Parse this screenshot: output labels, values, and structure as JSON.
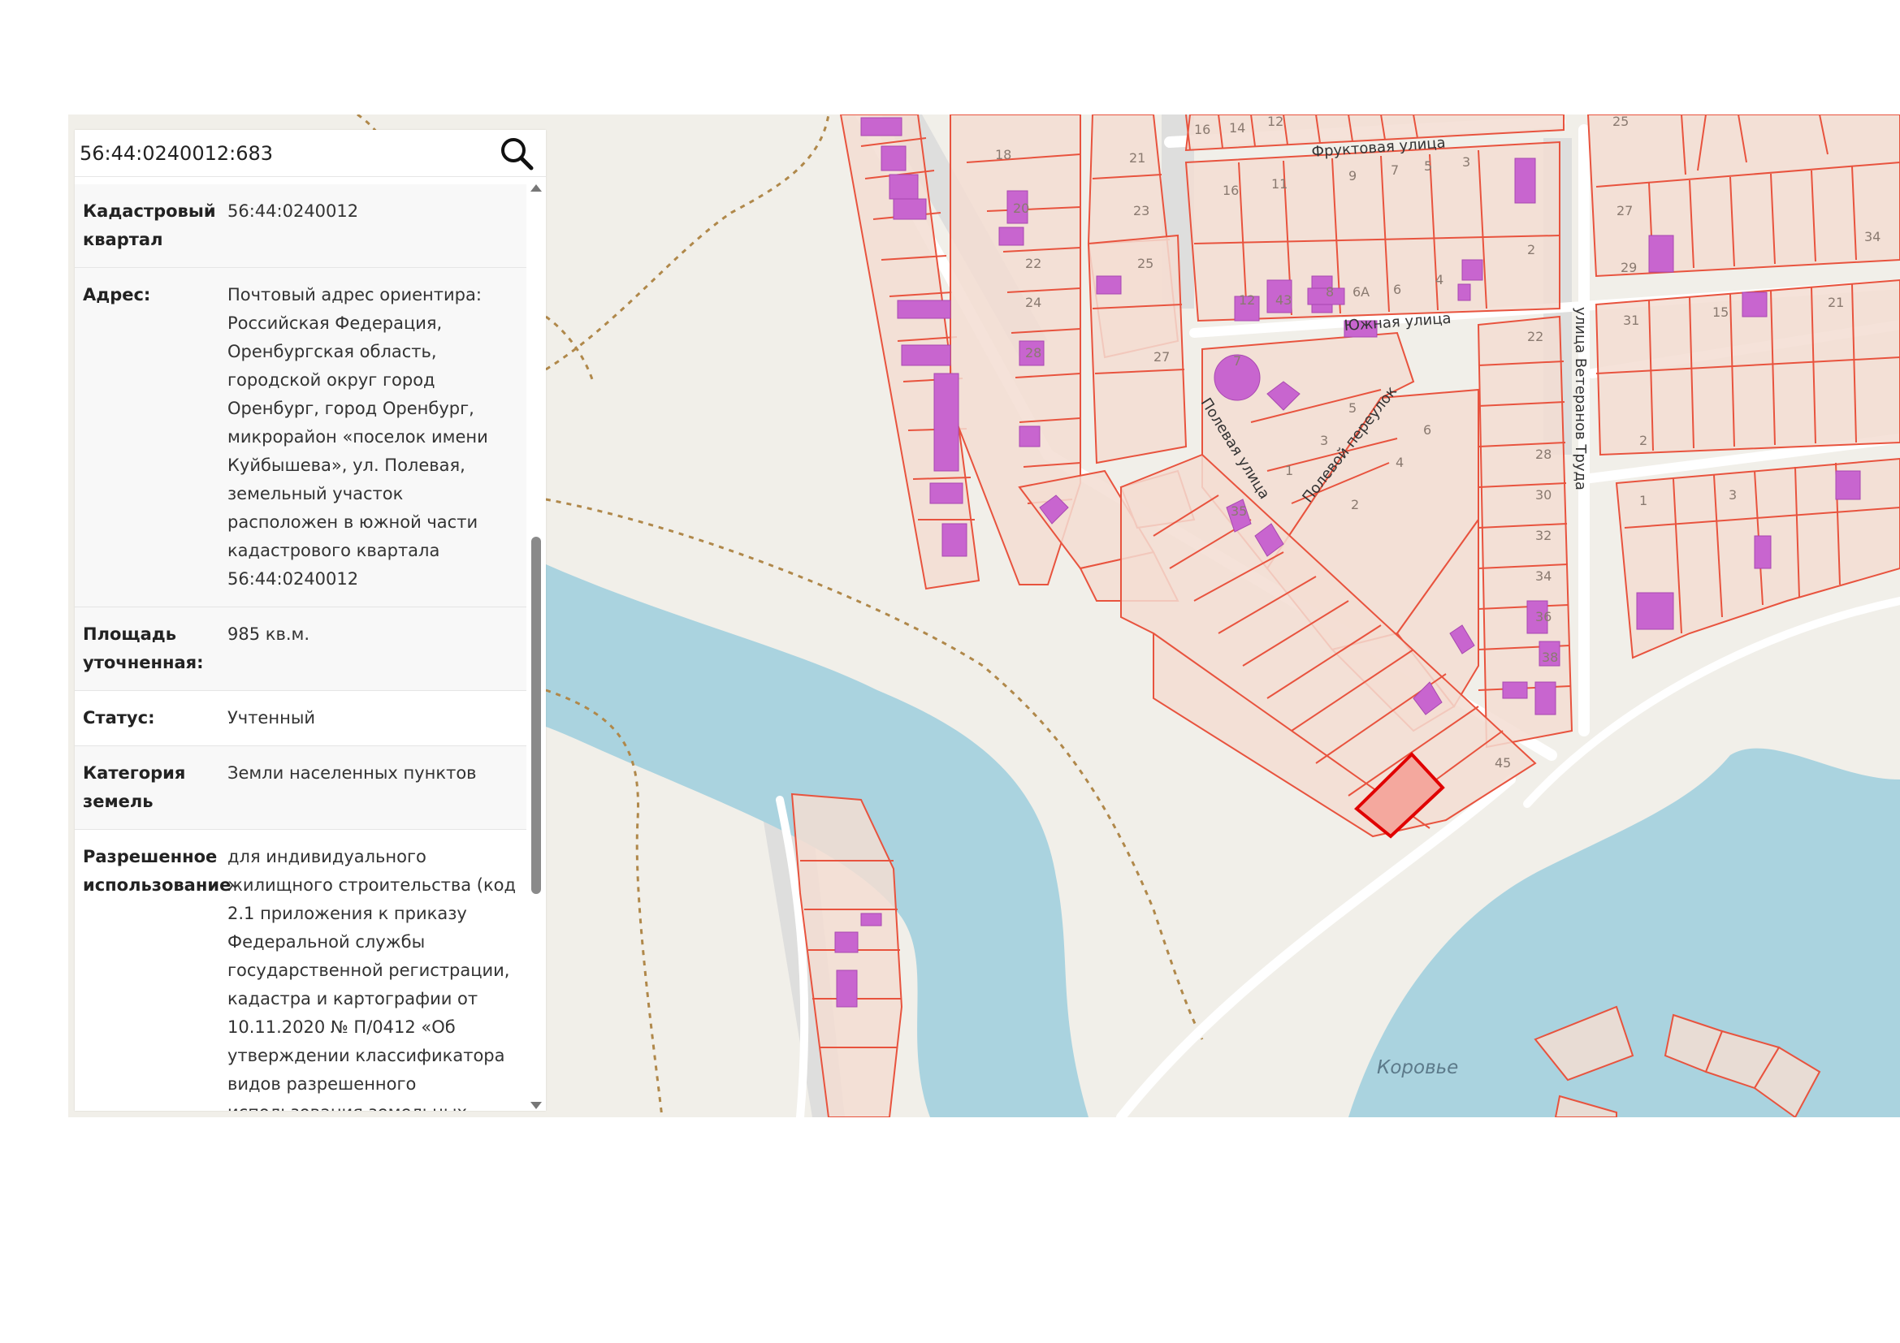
{
  "search": {
    "value": "56:44:0240012:683",
    "icon": "search-icon"
  },
  "parcel": {
    "rows": [
      {
        "label": "Кадастровый квартал",
        "value": "56:44:0240012"
      },
      {
        "label": "Адрес:",
        "value": "Почтовый адрес ориентира: Российская Федерация, Оренбургская область, городской округ город Оренбург, город Оренбург, микрорайон «поселок имени Куйбышева», ул. Полевая, земельный участок расположен в южной части кадастрового квартала 56:44:0240012"
      },
      {
        "label": "Площадь уточненная:",
        "value": "985 кв.м."
      },
      {
        "label": "Статус:",
        "value": "Учтенный"
      },
      {
        "label": "Категория земель",
        "value": "Земли населенных пунктов"
      },
      {
        "label": "Разрешенное использование",
        "value": "для индивидуального жилищного строительства (код 2.1 приложения к приказу Федеральной службы государственной регистрации, кадастра и картографии от 10.11.2020 № П/0412 «Об утверждении классификатора видов разрешенного использования земельных"
      }
    ]
  },
  "map": {
    "streets": {
      "fruktovaya": "Фруктовая улица",
      "yuzhnaya": "Южная улица",
      "polevaya": "Полевая улица",
      "polevoy_per": "Полевой переулок",
      "veteranov": "улица Ветеранов Труда"
    },
    "water_label": "Коровье",
    "parcel_numbers": [
      "16",
      "14",
      "12",
      "18",
      "21",
      "16",
      "11",
      "9",
      "7",
      "5",
      "3",
      "20",
      "23",
      "22",
      "25",
      "24",
      "28",
      "27",
      "12",
      "43",
      "8",
      "6А",
      "6",
      "4",
      "2",
      "25",
      "27",
      "29",
      "34",
      "31",
      "15",
      "21",
      "7",
      "5",
      "3",
      "1",
      "22",
      "6",
      "4",
      "2",
      "28",
      "30",
      "32",
      "34",
      "36",
      "38",
      "45",
      "35",
      "2",
      "1",
      "3"
    ],
    "colors": {
      "background": "#f1efe9",
      "water": "#aad3df",
      "parcel_fill": "#f3ddd2",
      "parcel_stroke": "#e8533e",
      "building": "#c865cf",
      "selected": "#e00000",
      "road": "#ffffff",
      "boundary": "#b0884a"
    }
  }
}
